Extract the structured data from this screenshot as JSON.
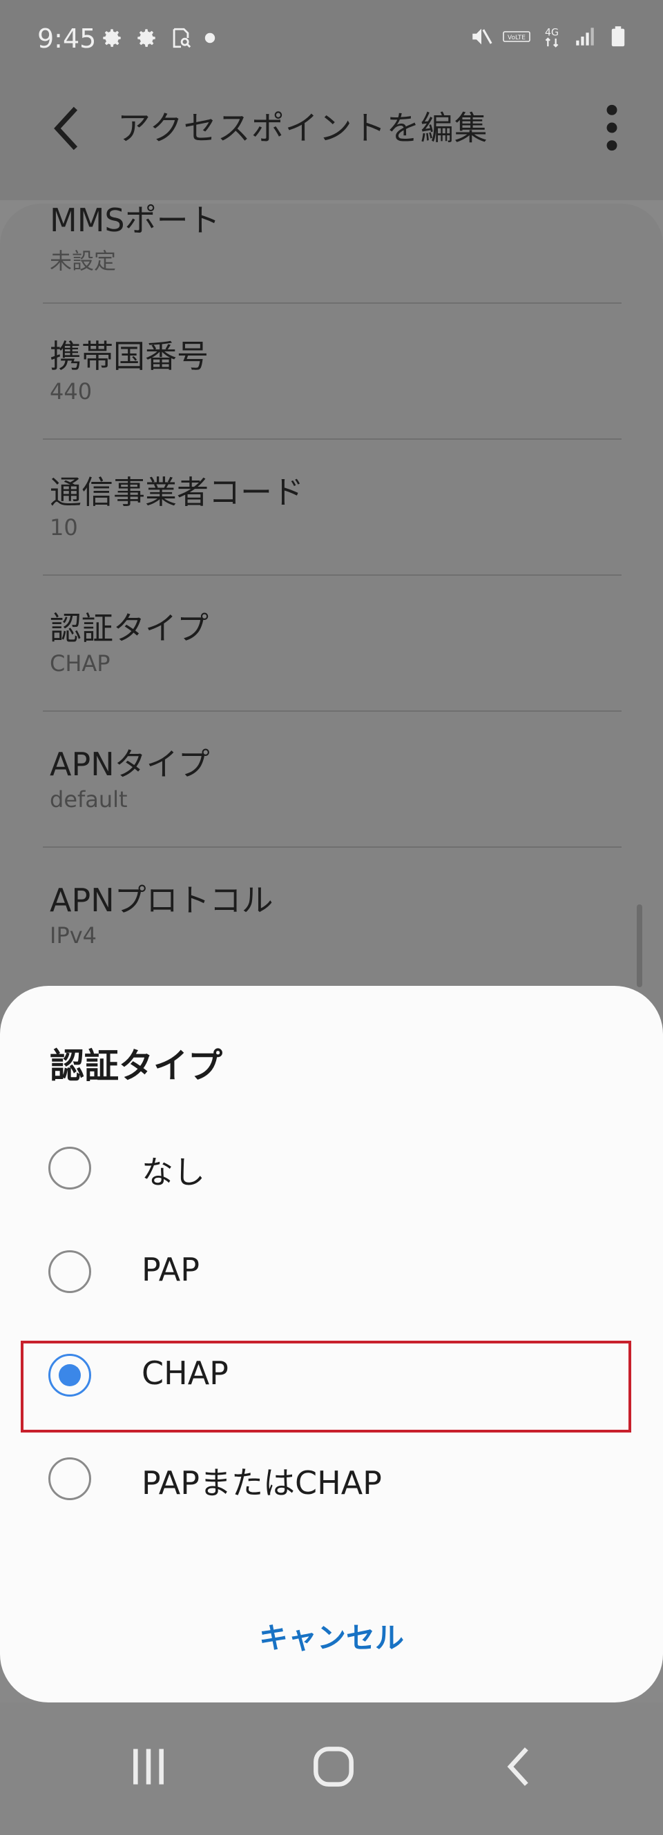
{
  "status_bar": {
    "time": "9:45",
    "left_icons": [
      "gear-icon",
      "gear-icon",
      "search-document-icon",
      "dot-icon"
    ],
    "right_icons": [
      "mute-icon",
      "volte-icon",
      "4g-icon",
      "signal-icon",
      "battery-icon"
    ],
    "network_label": "4G",
    "volte_label": "VoLTE"
  },
  "app_bar": {
    "title": "アクセスポイントを編集"
  },
  "settings": {
    "items": [
      {
        "title": "MMSポート",
        "value": "未設定"
      },
      {
        "title": "携帯国番号",
        "value": "440"
      },
      {
        "title": "通信事業者コード",
        "value": "10"
      },
      {
        "title": "認証タイプ",
        "value": "CHAP"
      },
      {
        "title": "APNタイプ",
        "value": "default"
      },
      {
        "title": "APNプロトコル",
        "value": "IPv4"
      }
    ]
  },
  "dialog": {
    "title": "認証タイプ",
    "options": [
      {
        "label": "なし",
        "selected": false
      },
      {
        "label": "PAP",
        "selected": false
      },
      {
        "label": "CHAP",
        "selected": true
      },
      {
        "label": "PAPまたはCHAP",
        "selected": false
      }
    ],
    "cancel_label": "キャンセル"
  },
  "colors": {
    "accent_blue": "#3b87e8",
    "cancel_blue": "#1872c4",
    "highlight_red": "#c8202c",
    "dim_overlay": "#888888",
    "sheet_bg": "#fbfbfb"
  },
  "nav_bar": {
    "icons": [
      "recent-apps-icon",
      "home-icon",
      "back-icon"
    ]
  }
}
